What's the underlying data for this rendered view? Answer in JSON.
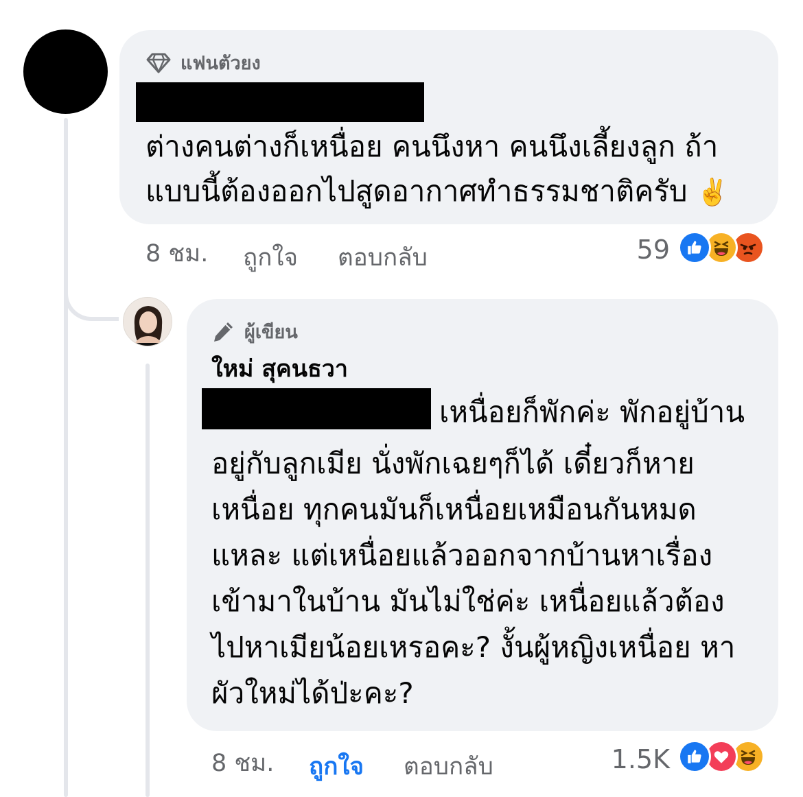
{
  "comment1": {
    "badge": "แฟนตัวยง",
    "badge_icon": "diamond-icon",
    "line1": "ต่างคนต่างก็เหนื่อย คนนึงหา คนนึงเลี้ยงลูก ถ้า",
    "line2": "แบบนี้ต้องออกไปสูดอากาศทำธรรมชาติครับ",
    "emoji": "✌️",
    "time": "8 ชม.",
    "like_label": "ถูกใจ",
    "reply_label": "ตอบกลับ",
    "reaction_count": "59",
    "reactions": [
      "like-icon",
      "haha-icon",
      "angry-icon"
    ]
  },
  "comment2": {
    "badge": "ผู้เขียน",
    "badge_icon": "pen-icon",
    "author": "ใหม่ สุคนธวา",
    "first_line": "เหนื่อยก็พักค่ะ พักอยู่บ้าน",
    "lines": [
      "อยู่กับลูกเมีย นั่งพักเฉยๆก็ได้ เดี๋ยวก็หาย",
      "เหนื่อย ทุกคนมันก็เหนื่อยเหมือนกันหมด",
      "แหละ แต่เหนื่อยแล้วออกจากบ้านหาเรื่อง",
      "เข้ามาในบ้าน มันไม่ใช่ค่ะ เหนื่อยแล้วต้อง",
      "ไปหาเมียน้อยเหรอคะ? งั้นผู้หญิงเหนื่อย หา",
      "ผัวใหม่ได้ป่ะคะ?"
    ],
    "time": "8 ชม.",
    "like_label": "ถูกใจ",
    "reply_label": "ตอบกลับ",
    "reaction_count": "1.5K",
    "reactions": [
      "like-icon",
      "love-icon",
      "haha-icon"
    ]
  },
  "colors": {
    "bubble": "#f0f2f5",
    "secondary_text": "#65676b",
    "accent": "#1877f2"
  }
}
